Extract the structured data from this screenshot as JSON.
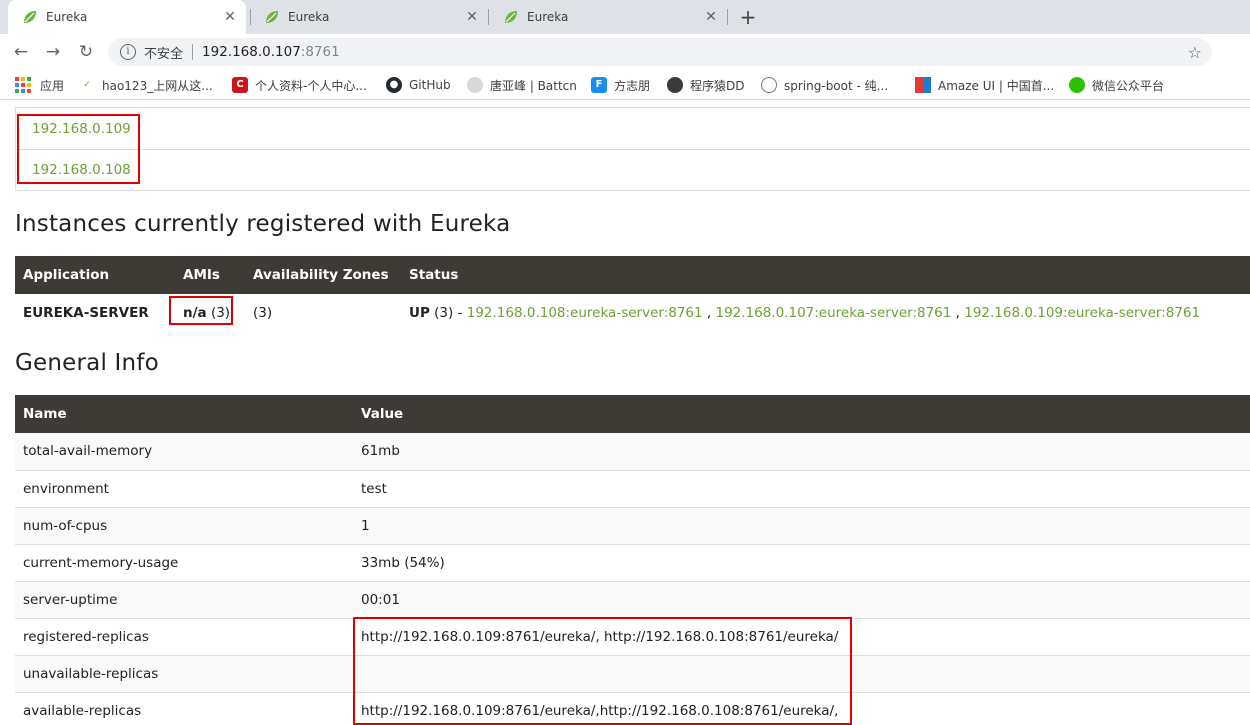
{
  "browser": {
    "tabs": [
      {
        "title": "Eureka",
        "active": true
      },
      {
        "title": "Eureka",
        "active": false
      },
      {
        "title": "Eureka",
        "active": false
      }
    ],
    "close_glyph": "✕",
    "new_tab_glyph": "+",
    "address": {
      "security_label": "不安全",
      "host": "192.168.0.107",
      "port": ":8761"
    },
    "bookmarks": [
      {
        "label": "应用",
        "icon": "apps-grid-icon"
      },
      {
        "label": "hao123_上网从这...",
        "icon": "hao123-icon"
      },
      {
        "label": "个人资料-个人中心...",
        "icon": "csdn-icon"
      },
      {
        "label": "GitHub",
        "icon": "github-icon"
      },
      {
        "label": "唐亚峰 | Battcn",
        "icon": "avatar-icon"
      },
      {
        "label": "方志朋",
        "icon": "f-icon"
      },
      {
        "label": "程序猿DD",
        "icon": "avatar-icon"
      },
      {
        "label": "spring-boot - 纯...",
        "icon": "globe-icon"
      },
      {
        "label": "Amaze UI | 中国首...",
        "icon": "amaze-icon"
      },
      {
        "label": "微信公众平台",
        "icon": "wechat-icon"
      }
    ]
  },
  "replicas": [
    "192.168.0.109",
    "192.168.0.108"
  ],
  "instances": {
    "heading": "Instances currently registered with Eureka",
    "columns": [
      "Application",
      "AMIs",
      "Availability Zones",
      "Status"
    ],
    "rows": [
      {
        "application": "EUREKA-SERVER",
        "amis_value": "n/a",
        "amis_count": " (3)",
        "zones": "(3)",
        "status": "UP",
        "status_count": " (3) - ",
        "links": [
          "192.168.0.108:eureka-server:8761",
          "192.168.0.107:eureka-server:8761",
          "192.168.0.109:eureka-server:8761"
        ],
        "link_sep": " , "
      }
    ]
  },
  "general_info": {
    "heading": "General Info",
    "columns": [
      "Name",
      "Value"
    ],
    "rows": [
      {
        "name": "total-avail-memory",
        "value": "61mb"
      },
      {
        "name": "environment",
        "value": "test"
      },
      {
        "name": "num-of-cpus",
        "value": "1"
      },
      {
        "name": "current-memory-usage",
        "value": "33mb (54%)"
      },
      {
        "name": "server-uptime",
        "value": "00:01"
      },
      {
        "name": "registered-replicas",
        "value": "http://192.168.0.109:8761/eureka/, http://192.168.0.108:8761/eureka/"
      },
      {
        "name": "unavailable-replicas",
        "value": ""
      },
      {
        "name": "available-replicas",
        "value": "http://192.168.0.109:8761/eureka/,http://192.168.0.108:8761/eureka/,"
      }
    ]
  },
  "colors": {
    "link_green": "#6da036",
    "header_dark": "#3e3b37",
    "highlight_red": "#e00000"
  }
}
